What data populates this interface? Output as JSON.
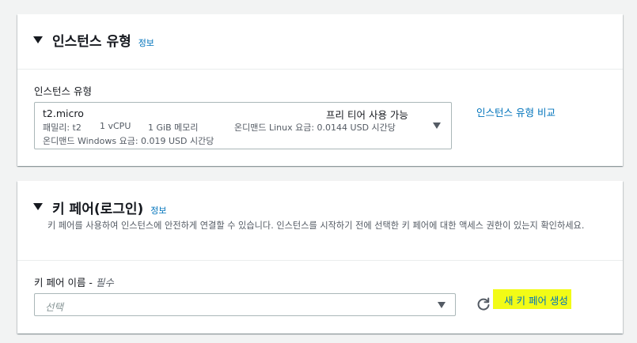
{
  "instance_type_panel": {
    "title": "인스턴스 유형",
    "info_link": "정보",
    "field_label": "인스턴스 유형",
    "selected": {
      "name": "t2.micro",
      "free_tier": "프리 티어 사용 가능",
      "family": "패밀리: t2",
      "vcpu": "1 vCPU",
      "memory": "1 GiB 메모리",
      "linux_price": "온디맨드 Linux 요금: 0.0144 USD 시간당",
      "windows_price": "온디맨드 Windows 요금: 0.019 USD 시간당"
    },
    "compare_link": "인스턴스 유형 비교"
  },
  "key_pair_panel": {
    "title": "키 페어(로그인)",
    "info_link": "정보",
    "description": "키 페어를 사용하여 인스턴스에 안전하게 연결할 수 있습니다. 인스턴스를 시작하기 전에 선택한 키 페어에 대한 액세스 권한이 있는지 확인하세요.",
    "field_label": "키 페어 이름 -",
    "field_required": "필수",
    "select_placeholder": "선택",
    "create_link": "새 키 페어 생성",
    "refresh_icon": "refresh-icon"
  },
  "colors": {
    "link": "#0073bb",
    "highlight": "#f2fb16",
    "background": "#f2f3f3"
  }
}
